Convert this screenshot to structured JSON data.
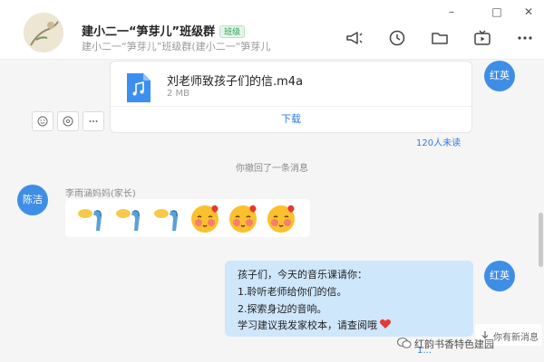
{
  "header": {
    "title": "建小二一“笋芽儿”班级群",
    "badge": "班级",
    "subtitle": "建小二一“笋芽儿”班级群(建小二一“笋芽儿",
    "window": {
      "minimize": "–",
      "maximize": "□",
      "close": "✕"
    },
    "tools": [
      "announce-icon",
      "chat-history-icon",
      "folder-icon",
      "live-icon",
      "more-icon"
    ]
  },
  "file_message": {
    "sender": "红英",
    "file_name": "刘老师致孩子们的信.m4a",
    "file_size": "2 MB",
    "download_label": "下载",
    "read_status": "120人未读"
  },
  "system_message": "你撤回了一条消息",
  "emoji_message": {
    "sender_avatar": "陈洁",
    "sender_name": "李雨涵妈妈(家长)",
    "emojis": [
      "thumbs",
      "thumbs",
      "thumbs",
      "blush",
      "blush",
      "blush"
    ]
  },
  "my_message": {
    "sender": "红英",
    "lines": [
      "孩子们，今天的音乐课请你：",
      "1.聆听老师给你们的信。",
      "2.探索身边的音响。",
      "学习建议我发家校本，请查阅哦"
    ],
    "read_status": "1..."
  },
  "new_message_label": "你有新消息",
  "watermark": "红韵书香特色建园",
  "colors": {
    "accent": "#2c7be5",
    "avatar_blue": "#3e8ee6",
    "bubble_self": "#cfe7fb"
  }
}
